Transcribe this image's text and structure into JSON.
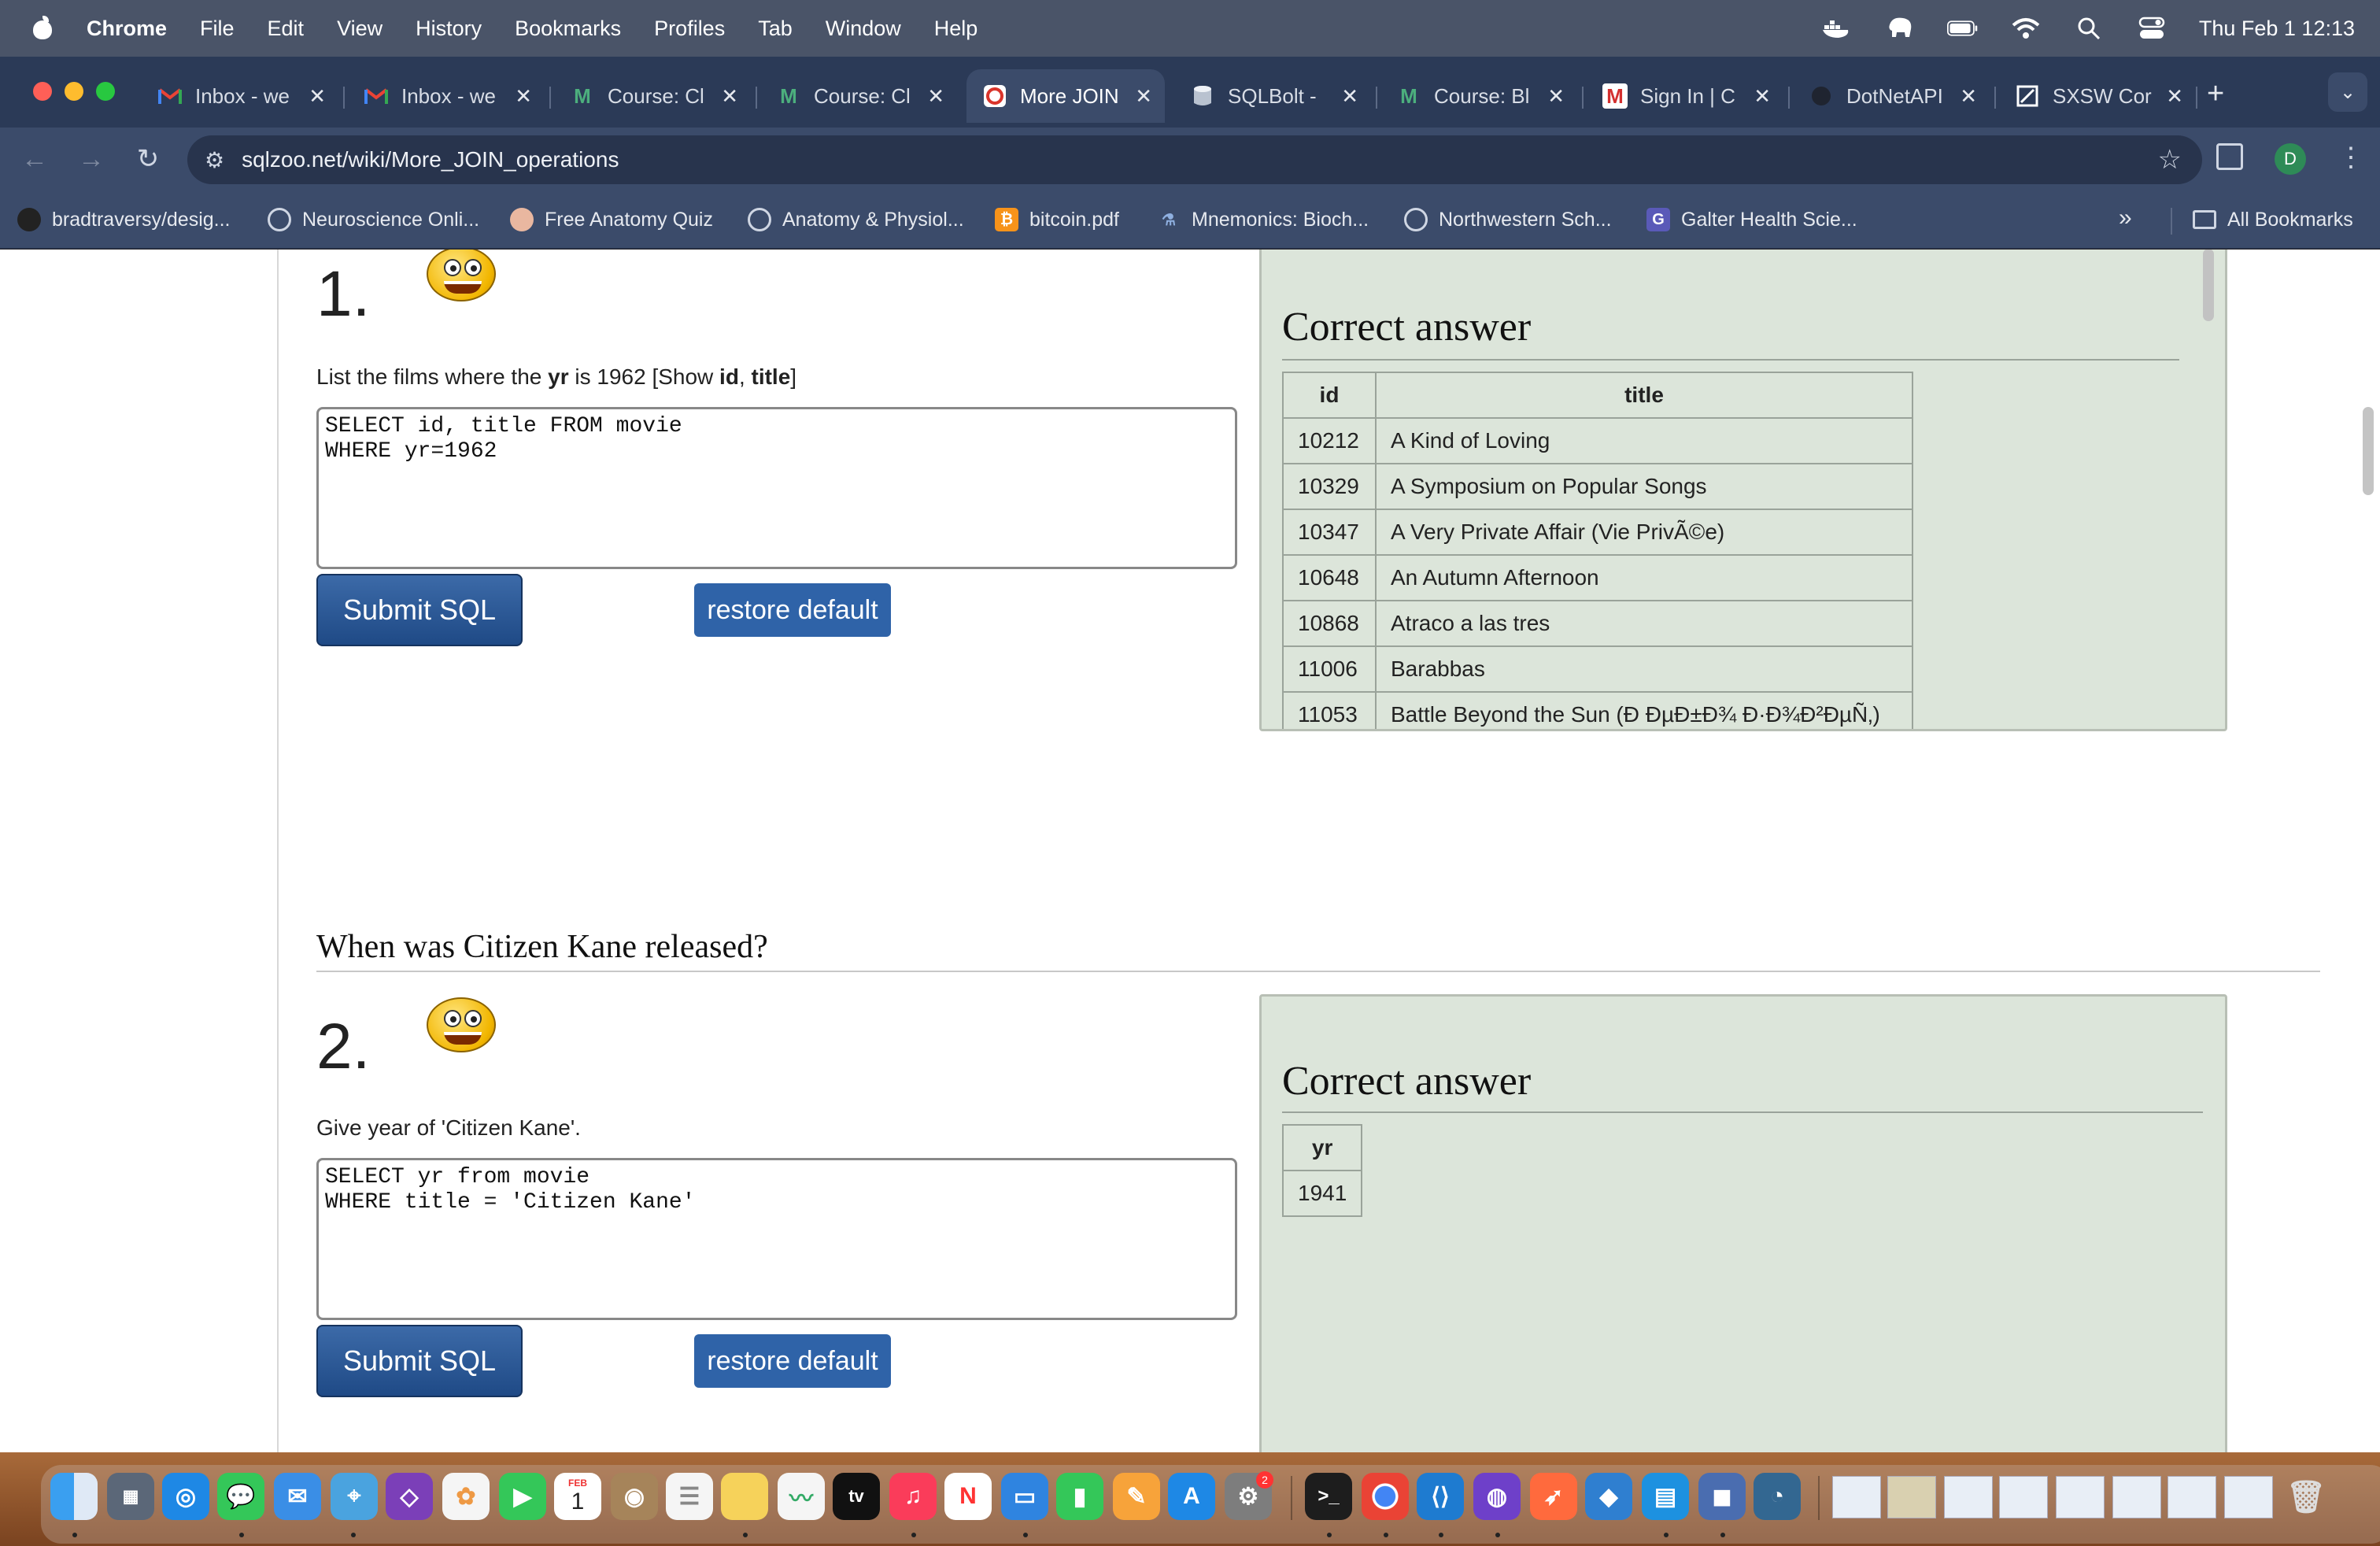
{
  "menubar": {
    "app": "Chrome",
    "items": [
      "File",
      "Edit",
      "View",
      "History",
      "Bookmarks",
      "Profiles",
      "Tab",
      "Window",
      "Help"
    ],
    "clock": "Thu Feb 1  12:13"
  },
  "tabs": [
    {
      "label": "Inbox - we",
      "icon": "gmail-icon"
    },
    {
      "label": "Inbox - we",
      "icon": "gmail-icon"
    },
    {
      "label": "Course: Cl",
      "icon": "m-logo-icon"
    },
    {
      "label": "Course: Cl",
      "icon": "m-logo-icon"
    },
    {
      "label": "More JOIN",
      "icon": "sqlzoo-icon",
      "active": true
    },
    {
      "label": "SQLBolt -",
      "icon": "database-icon"
    },
    {
      "label": "Course: Bl",
      "icon": "m-logo-icon"
    },
    {
      "label": "Sign In | C",
      "icon": "m-red-icon"
    },
    {
      "label": "DotNetAPI",
      "icon": "github-icon"
    },
    {
      "label": "SXSW Cor",
      "icon": "sxsw-icon"
    }
  ],
  "toolbar": {
    "url": "sqlzoo.net/wiki/More_JOIN_operations",
    "profile_initial": "D"
  },
  "bookmarks": [
    "bradtraversy/desig...",
    "Neuroscience Onli...",
    "Free Anatomy Quiz",
    "Anatomy & Physiol...",
    "bitcoin.pdf",
    "Mnemonics: Bioch...",
    "Northwestern Sch...",
    "Galter Health Scie..."
  ],
  "all_bookmarks": "All Bookmarks",
  "q1": {
    "number": "1.",
    "prompt_pre": "List the films where the ",
    "prompt_bold1": "yr",
    "prompt_mid": " is 1962 [Show ",
    "prompt_bold2": "id",
    "prompt_comma": ", ",
    "prompt_bold3": "title",
    "prompt_end": "]",
    "sql": "SELECT id, title FROM movie\nWHERE yr=1962",
    "submit": "Submit SQL",
    "restore": "restore default",
    "answer_title": "Correct answer",
    "columns": [
      "id",
      "title"
    ],
    "rows": [
      [
        "10212",
        "A Kind of Loving"
      ],
      [
        "10329",
        "A Symposium on Popular Songs"
      ],
      [
        "10347",
        "A Very Private Affair (Vie PrivÃ©e)"
      ],
      [
        "10648",
        "An Autumn Afternoon"
      ],
      [
        "10868",
        "Atraco a las tres"
      ],
      [
        "11006",
        "Barabbas"
      ],
      [
        "11053",
        "Battle Beyond the Sun (Ð    ÐµÐ±Ð¾ Ð·Ð¾Ð²ÐµÑ‚)"
      ]
    ]
  },
  "q2": {
    "heading": "When was Citizen Kane released?",
    "number": "2.",
    "prompt": "Give year of 'Citizen Kane'.",
    "sql": "SELECT yr from movie\nWHERE title = 'Citizen Kane'",
    "submit": "Submit SQL",
    "restore": "restore default",
    "answer_title": "Correct answer",
    "columns": [
      "yr"
    ],
    "rows": [
      [
        "1941"
      ]
    ]
  },
  "dock": {
    "calendar_month": "FEB",
    "calendar_day": "1",
    "appletv": "tv",
    "settings_badge": "2"
  }
}
